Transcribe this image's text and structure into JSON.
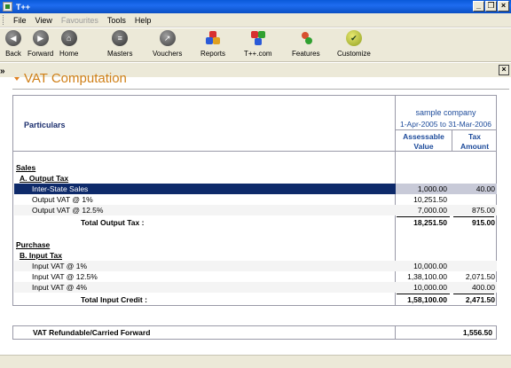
{
  "window": {
    "title": "T++"
  },
  "menu": [
    {
      "label": "File",
      "disabled": false
    },
    {
      "label": "View",
      "disabled": false
    },
    {
      "label": "Favourites",
      "disabled": true
    },
    {
      "label": "Tools",
      "disabled": false
    },
    {
      "label": "Help",
      "disabled": false
    }
  ],
  "toolbar": {
    "back": "Back",
    "forward": "Forward",
    "home": "Home",
    "masters": "Masters",
    "vouchers": "Vouchers",
    "reports": "Reports",
    "tpp": "T++.com",
    "features": "Features",
    "customize": "Customize"
  },
  "page": {
    "title": "VAT Computation"
  },
  "report": {
    "particulars_header": "Particulars",
    "company": "sample company",
    "period": "1-Apr-2005 to 31-Mar-2006",
    "col_assessable_1": "Assessable",
    "col_assessable_2": "Value",
    "col_tax_1": "Tax",
    "col_tax_2": "Amount",
    "sales": "Sales",
    "output_tax": "A. Output Tax",
    "rows_output": [
      {
        "label": "Inter-State Sales",
        "value": "1,000.00",
        "tax": "40.00"
      },
      {
        "label": "Output VAT @ 1%",
        "value": "10,251.50",
        "tax": ""
      },
      {
        "label": "Output VAT @ 12.5%",
        "value": "7,000.00",
        "tax": "875.00"
      }
    ],
    "total_output": {
      "label": "Total Output Tax :",
      "value": "18,251.50",
      "tax": "915.00"
    },
    "purchase": "Purchase",
    "input_tax": "B. Input Tax",
    "rows_input": [
      {
        "label": "Input VAT @ 1%",
        "value": "10,000.00",
        "tax": ""
      },
      {
        "label": "Input VAT @ 12.5%",
        "value": "1,38,100.00",
        "tax": "2,071.50"
      },
      {
        "label": "Input VAT @ 4%",
        "value": "10,000.00",
        "tax": "400.00"
      }
    ],
    "total_input": {
      "label": "Total Input Credit :",
      "value": "1,58,100.00",
      "tax": "2,471.50"
    }
  },
  "summary": {
    "label": "VAT Refundable/Carried Forward",
    "value": "1,556.50"
  },
  "colors": {
    "title_orange": "#d08018",
    "header_blue": "#1c4a9a",
    "selected_row": "#0e2a6a"
  }
}
